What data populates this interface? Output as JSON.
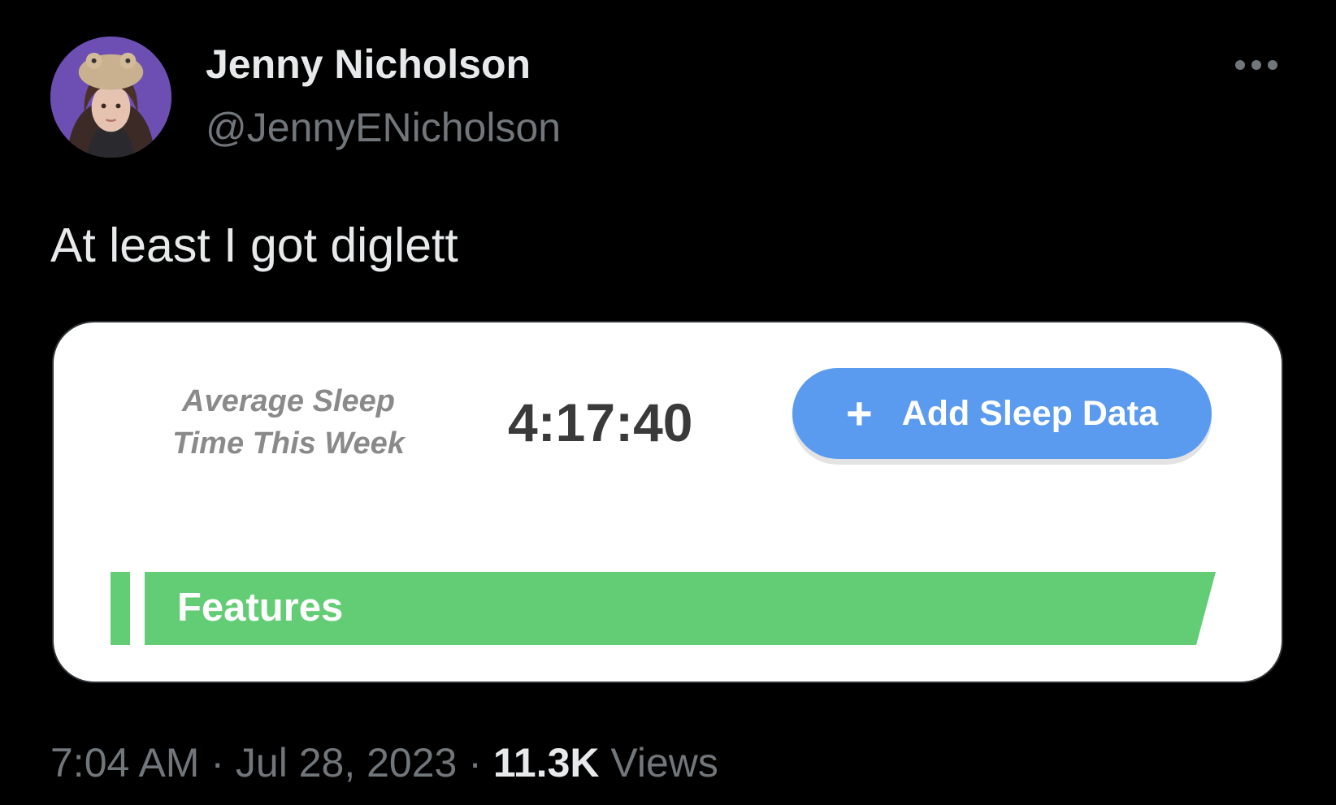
{
  "tweet": {
    "author": {
      "display_name": "Jenny Nicholson",
      "handle": "@JennyENicholson",
      "avatar_icon": "profile-photo"
    },
    "more_icon": "ellipsis-icon",
    "text": "At least I got diglett",
    "media": {
      "average_label_line1": "Average Sleep",
      "average_label_line2": "Time This Week",
      "average_time": "4:17:40",
      "add_button": {
        "icon": "plus-icon",
        "icon_glyph": "+",
        "label": "Add Sleep Data",
        "color": "#5b9bef"
      },
      "features_label": "Features",
      "features_color": "#63cd75"
    },
    "time": "7:04 AM",
    "separator": "·",
    "date": "Jul 28, 2023",
    "views_count": "11.3K",
    "views_label": "Views"
  }
}
